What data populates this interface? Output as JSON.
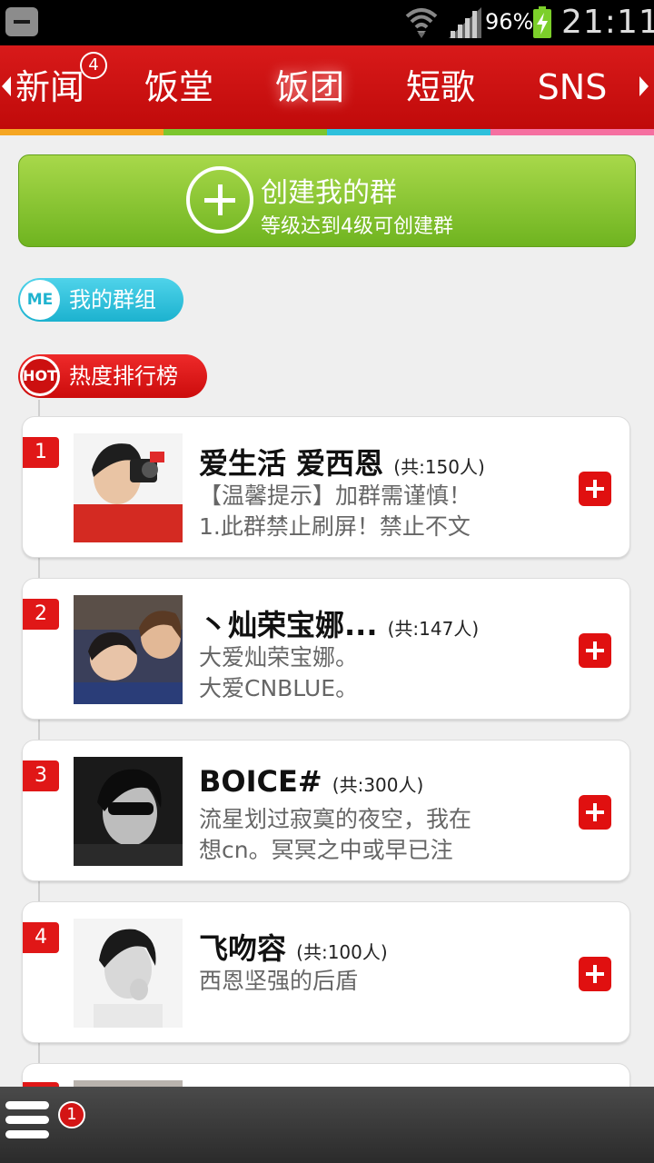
{
  "status_bar": {
    "battery_percent": "96%",
    "time": "21:11",
    "icons": [
      "back-icon",
      "wifi-icon",
      "signal-icon",
      "battery-charging-icon"
    ]
  },
  "tabs": {
    "items": [
      {
        "label": "新闻",
        "badge": "4"
      },
      {
        "label": "饭堂"
      },
      {
        "label": "饭团",
        "active": true
      },
      {
        "label": "短歌"
      },
      {
        "label": "SNS"
      }
    ],
    "colors": [
      "#f5a623",
      "#7cc62e",
      "#2ec0dc",
      "#f56fa0"
    ]
  },
  "create_group": {
    "title": "创建我的群",
    "subtitle": "等级达到4级可创建群"
  },
  "my_groups": {
    "icon_text": "ME",
    "label": "我的群组"
  },
  "hot_ranking": {
    "icon_text": "HOT",
    "label": "热度排行榜"
  },
  "groups": [
    {
      "rank": "1",
      "name": "爱生活 爱西恩",
      "count": "(共:150人)",
      "desc": [
        "【温馨提示】加群需谨慎！",
        "1.此群禁止刷屏！禁止不文"
      ]
    },
    {
      "rank": "2",
      "name": "丶灿荣宝娜...",
      "count": "(共:147人)",
      "desc": [
        "大爱灿荣宝娜。",
        "大爱CNBLUE。"
      ]
    },
    {
      "rank": "3",
      "name": "BOICE#",
      "count": "(共:300人)",
      "desc": [
        "流星划过寂寞的夜空，我在",
        "想cn。冥冥之中或早已注"
      ]
    },
    {
      "rank": "4",
      "name": "飞吻容",
      "count": "(共:100人)",
      "desc": [
        "西恩坚强的后盾",
        ""
      ]
    }
  ],
  "bottom_bar": {
    "menu_badge": "1"
  }
}
